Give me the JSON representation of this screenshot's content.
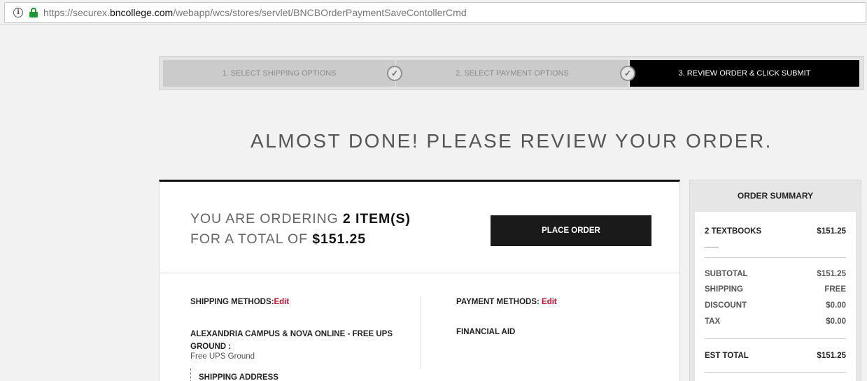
{
  "browser": {
    "url_prefix": "https://securex.",
    "url_domain": "bncollege.com",
    "url_path": "/webapp/wcs/stores/servlet/BNCBOrderPaymentSaveContollerCmd"
  },
  "steps": [
    {
      "label": "1. SELECT SHIPPING OPTIONS",
      "state": "done"
    },
    {
      "label": "2. SELECT PAYMENT OPTIONS",
      "state": "done"
    },
    {
      "label": "3. REVIEW ORDER & CLICK SUBMIT",
      "state": "active"
    }
  ],
  "check_glyph": "✓",
  "headline": "ALMOST DONE! PLEASE REVIEW YOUR ORDER.",
  "order": {
    "line1_prefix": "YOU ARE ORDERING ",
    "line1_value": "2 ITEM(S)",
    "line2_prefix": "FOR A TOTAL OF ",
    "line2_value": "$151.25",
    "place_order_label": "PLACE ORDER"
  },
  "shipping": {
    "label": "SHIPPING METHODS:",
    "edit_label": "Edit",
    "method_name": "ALEXANDRIA CAMPUS & NOVA ONLINE - FREE UPS GROUND :",
    "method_sub": "Free UPS Ground",
    "address_label": "SHIPPING ADDRESS"
  },
  "payment": {
    "label": "PAYMENT METHODS: ",
    "edit_label": "Edit",
    "method": "FINANCIAL AID"
  },
  "summary": {
    "title": "ORDER SUMMARY",
    "items_label": "2 TEXTBOOKS",
    "items_value": "$151.25",
    "subtotal_label": "SUBTOTAL",
    "subtotal_value": "$151.25",
    "shipping_label": "SHIPPING",
    "shipping_value": "FREE",
    "discount_label": "DISCOUNT",
    "discount_value": "$0.00",
    "tax_label": "TAX",
    "tax_value": "$0.00",
    "total_label": "EST TOTAL",
    "total_value": "$151.25"
  },
  "colors": {
    "accent_edit": "#c8102e",
    "lock_green": "#1a9c32",
    "active_step": "#000000"
  }
}
